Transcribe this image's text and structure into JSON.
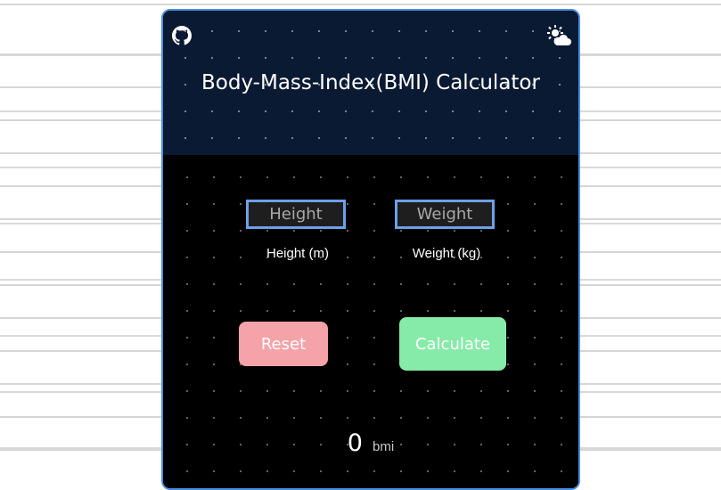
{
  "app": {
    "title": "Body-Mass-Index(BMI) Calculator"
  },
  "header": {
    "github_icon": "github-icon",
    "theme_icon": "sun-cloud-icon"
  },
  "form": {
    "height": {
      "placeholder": "Height",
      "value": "",
      "label": "Height (m)"
    },
    "weight": {
      "placeholder": "Weight",
      "value": "",
      "label": "Weight (kg)"
    }
  },
  "buttons": {
    "reset_label": "Reset",
    "calculate_label": "Calculate"
  },
  "result": {
    "value": "0",
    "unit": "bmi"
  },
  "colors": {
    "header_bg": "#0b1a33",
    "body_bg": "#000000",
    "card_border": "#4a90e2",
    "input_border": "#6ea0e8",
    "reset_bg": "#f4a3a8",
    "calculate_bg": "#86eba8"
  }
}
